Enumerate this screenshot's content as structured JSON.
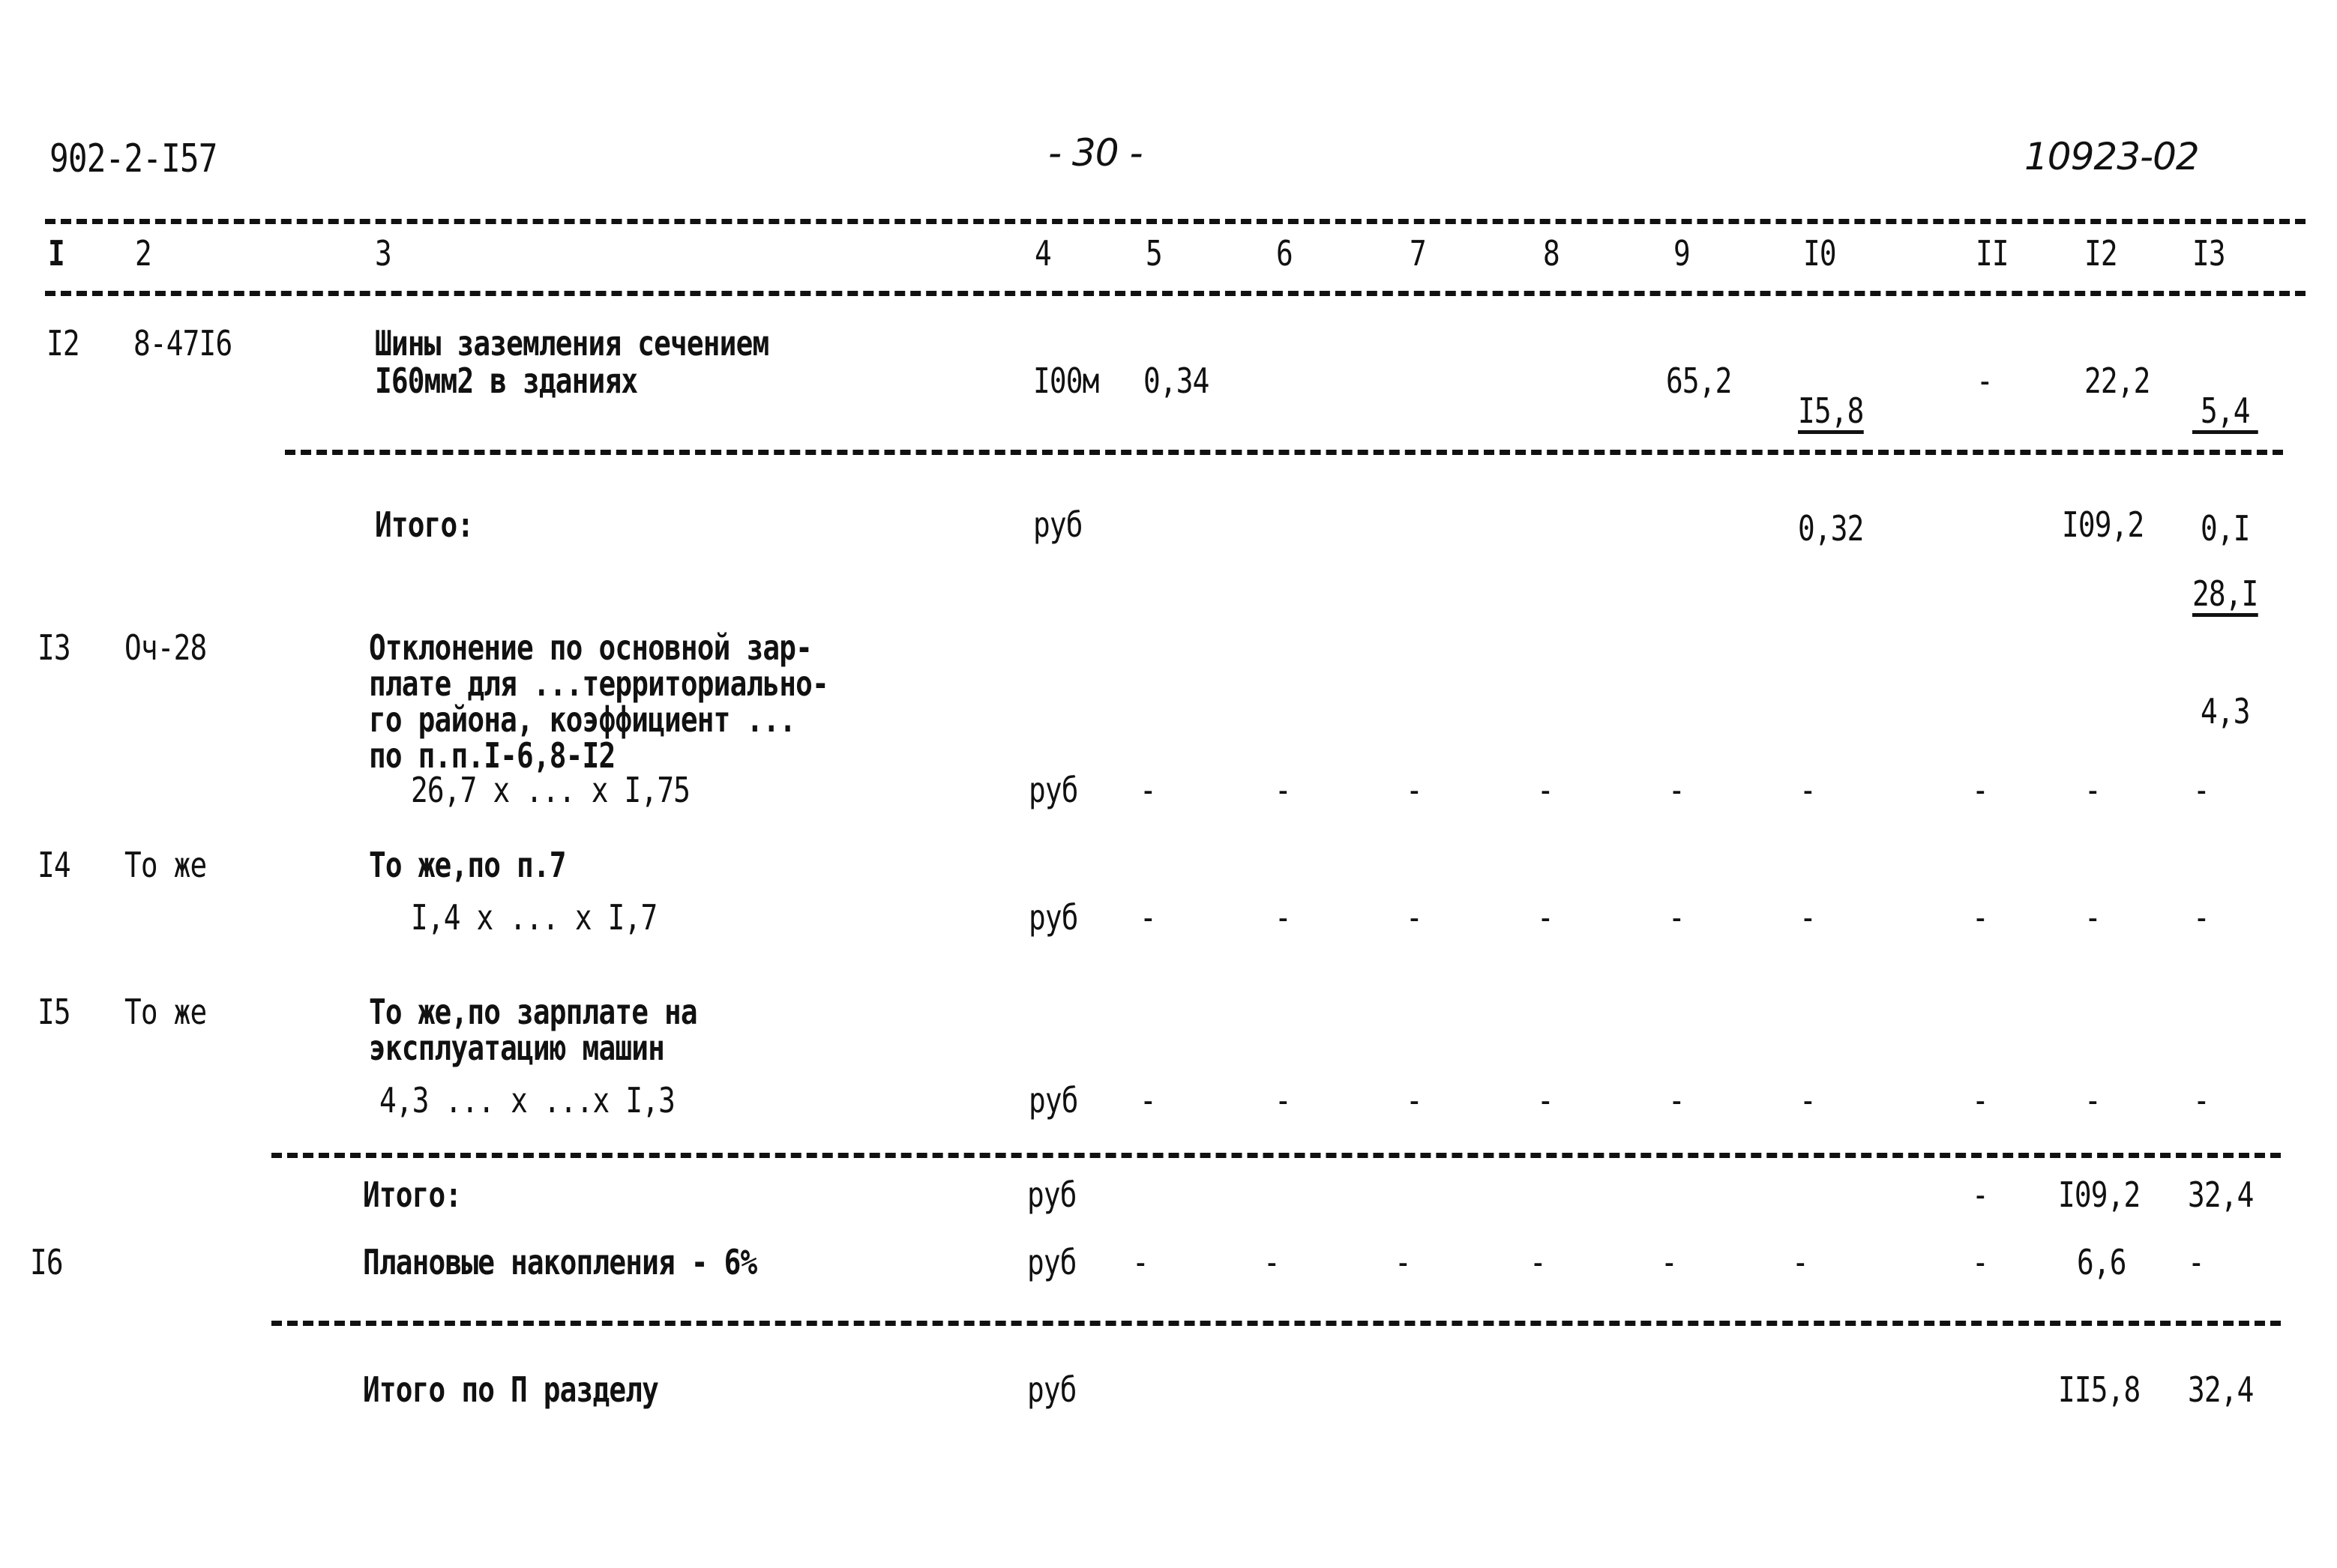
{
  "header": {
    "doc_code": "902-2-I57",
    "page_number": "- 30 -",
    "sheet_code": "10923-02"
  },
  "columns": [
    "I",
    "2",
    "3",
    "4",
    "5",
    "6",
    "7",
    "8",
    "9",
    "I0",
    "II",
    "I2",
    "I3"
  ],
  "rows": {
    "r12": {
      "num": "I2",
      "code": "8-47I6",
      "desc": [
        "Шины заземления сечением",
        "I60мм2 в зданиях"
      ],
      "unit": "I00м",
      "qty": "0,34",
      "c9": "65,2",
      "c10_top": "I5,8",
      "c10_bottom": "0,32",
      "c11": "-",
      "c12": "22,2",
      "c13_top": "5,4",
      "c13_bottom": "0,I"
    },
    "total1": {
      "label": "Итого:",
      "unit": "руб",
      "c12": "I09,2",
      "c13_top": "28,I",
      "c13_bottom": "4,3"
    },
    "r13": {
      "num": "I3",
      "code": "Оч-28",
      "desc": [
        "Отклонение по основной зар-",
        "плате для ...территориально-",
        "го района, коэффициент ...",
        "по п.п.I-6,8-I2"
      ],
      "formula": "26,7 х ... х I,75",
      "unit": "руб",
      "dashes": [
        "-",
        "-",
        "-",
        "-",
        "-",
        "-",
        "-",
        "-",
        "-"
      ]
    },
    "r14": {
      "num": "I4",
      "code": "То же",
      "desc": [
        "То же,по п.7"
      ],
      "formula": "I,4 х ... х I,7",
      "unit": "руб",
      "dashes": [
        "-",
        "-",
        "-",
        "-",
        "-",
        "-",
        "-",
        "-",
        "-"
      ]
    },
    "r15": {
      "num": "I5",
      "code": "То же",
      "desc": [
        "То же,по зарплате на",
        "эксплуатацию машин"
      ],
      "formula": "4,3 ... х ...х I,3",
      "unit": "руб",
      "dashes": [
        "-",
        "-",
        "-",
        "-",
        "-",
        "-",
        "-",
        "-",
        "-"
      ]
    },
    "total2": {
      "label": "Итого:",
      "unit": "руб",
      "c11": "-",
      "c12": "I09,2",
      "c13": "32,4"
    },
    "r16": {
      "num": "I6",
      "desc": "Плановые накопления - 6%",
      "unit": "руб",
      "dashes": [
        "-",
        "-",
        "-",
        "-",
        "-",
        "-",
        "-"
      ],
      "c12": "6,6",
      "c13": "-"
    },
    "grand_total": {
      "label": "Итого по П разделу",
      "unit": "руб",
      "c12": "II5,8",
      "c13": "32,4"
    }
  }
}
